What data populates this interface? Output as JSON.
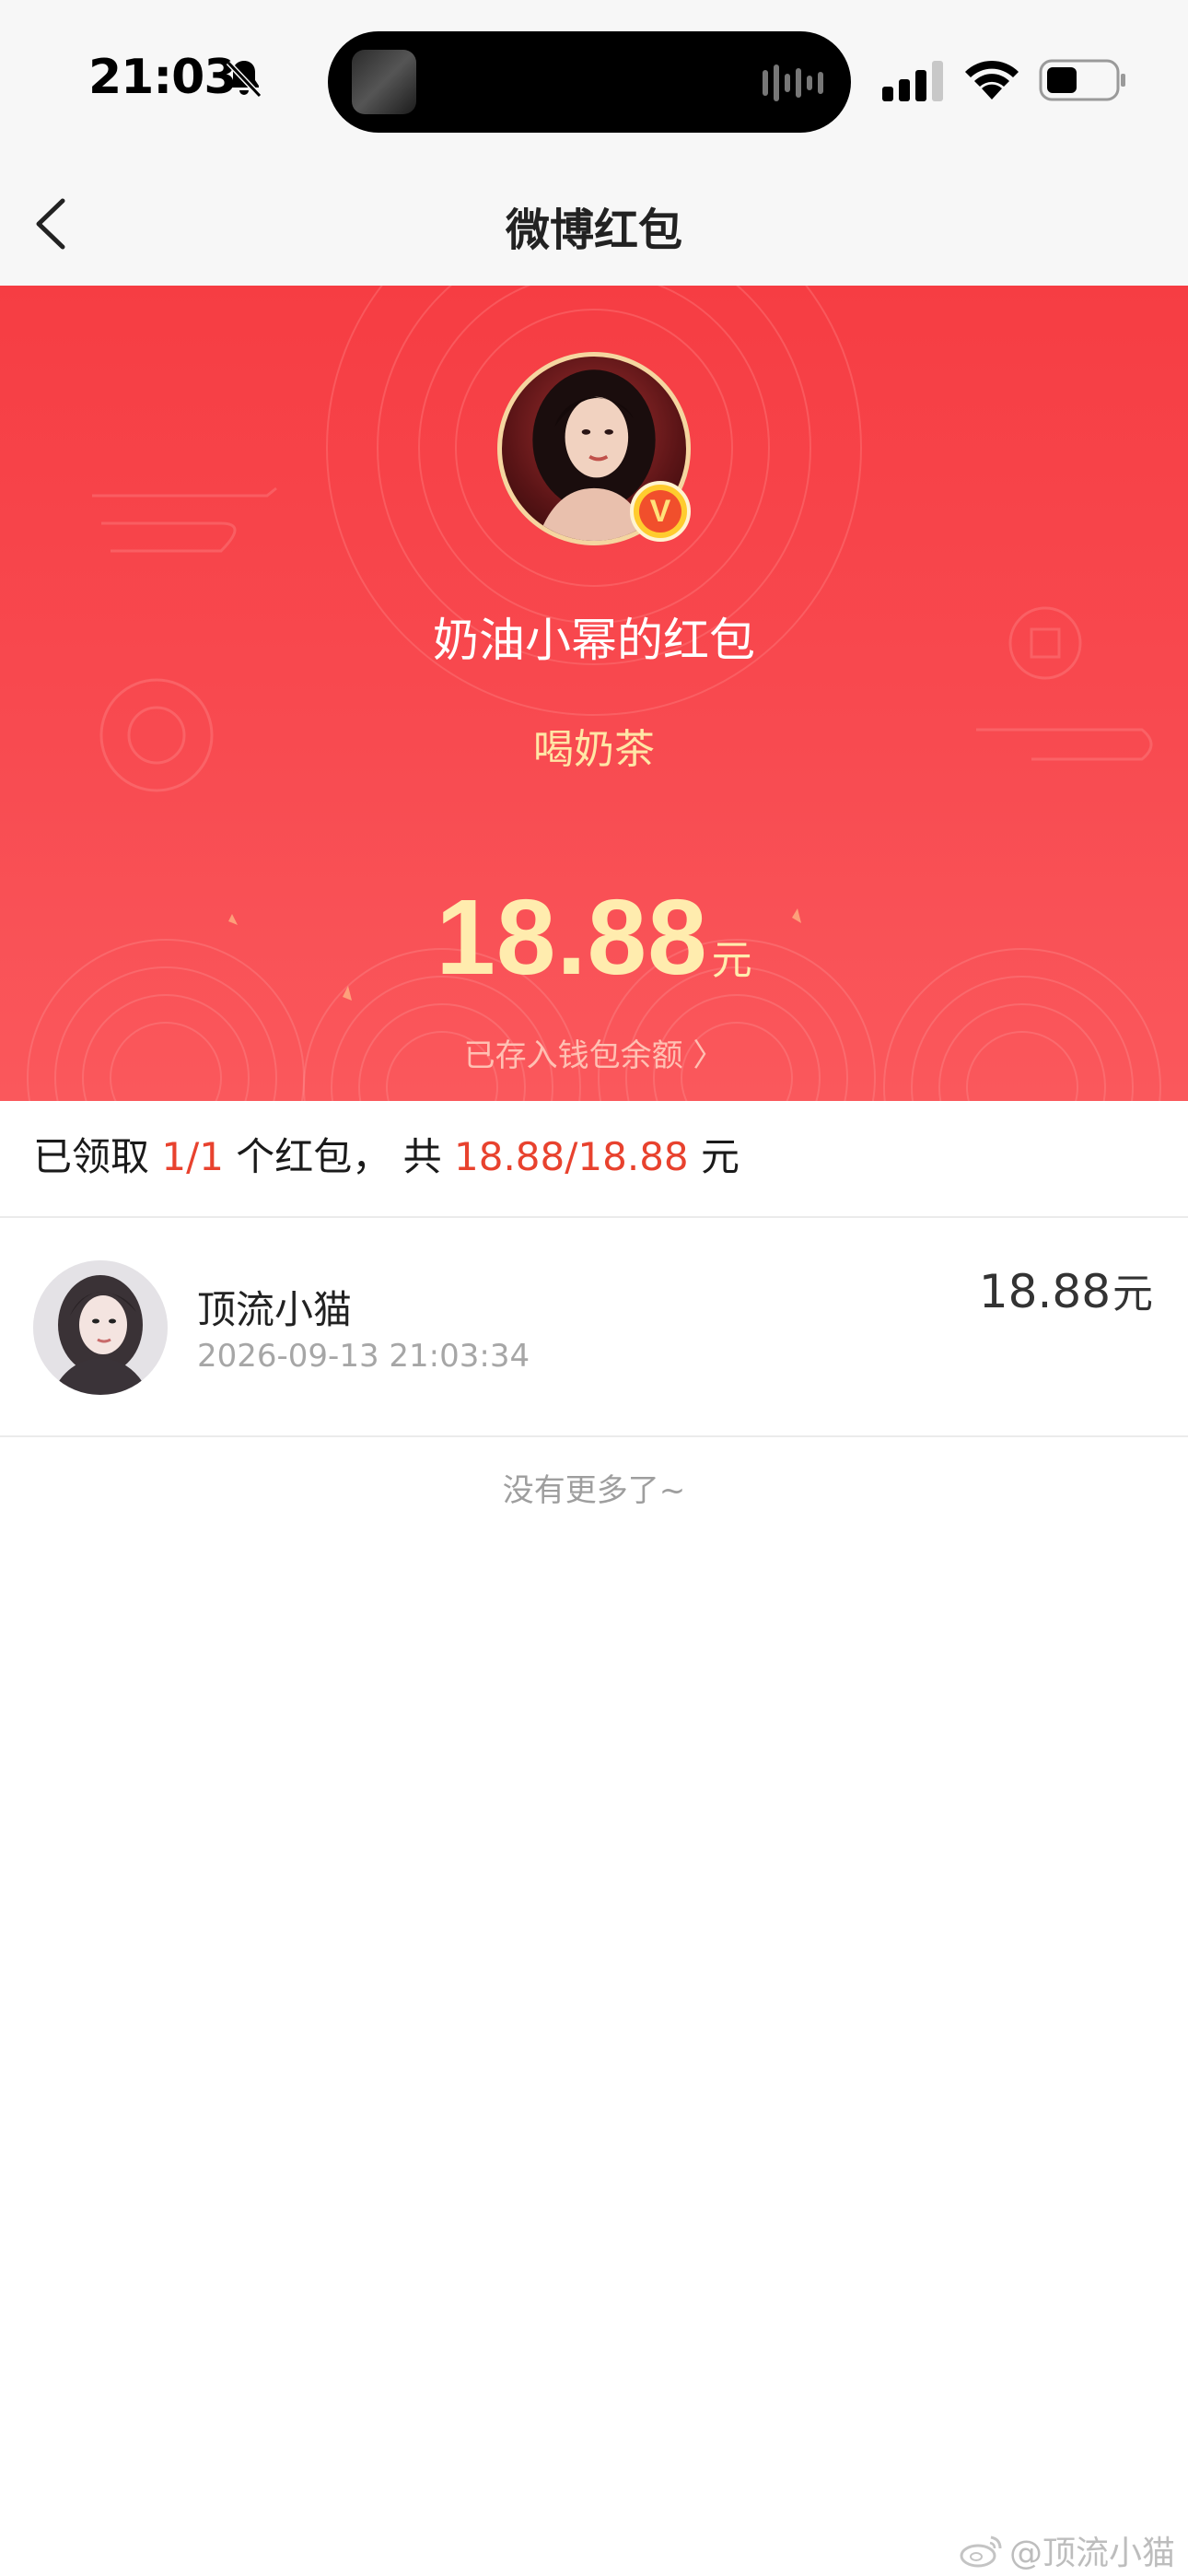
{
  "status_bar": {
    "time": "21:03"
  },
  "nav": {
    "title": "微博红包"
  },
  "header": {
    "sender_title": "奶油小幂的红包",
    "blessing": "喝奶茶",
    "amount": "18.88",
    "amount_unit": "元",
    "wallet_link": "已存入钱包余额 〉",
    "vip_badge": "V",
    "colors": {
      "red_top": "#f63d43",
      "red_bottom": "#fa585c",
      "gold_text": "#ffecae"
    }
  },
  "summary": {
    "prefix": "已领取 ",
    "claimed": "1/1",
    "middle": " 个红包， 共 ",
    "total": "18.88/18.88",
    "suffix": " 元"
  },
  "recipients": [
    {
      "name": "顶流小猫",
      "time": "2026-09-13 21:03:34",
      "amount": "18.88",
      "unit": "元"
    }
  ],
  "footer": {
    "no_more": "没有更多了~",
    "watermark": "@顶流小猫"
  },
  "icons": [
    "bell-slash-icon",
    "signal-icon",
    "wifi-icon",
    "battery-icon",
    "back-arrow-icon",
    "weibo-logo-icon"
  ]
}
